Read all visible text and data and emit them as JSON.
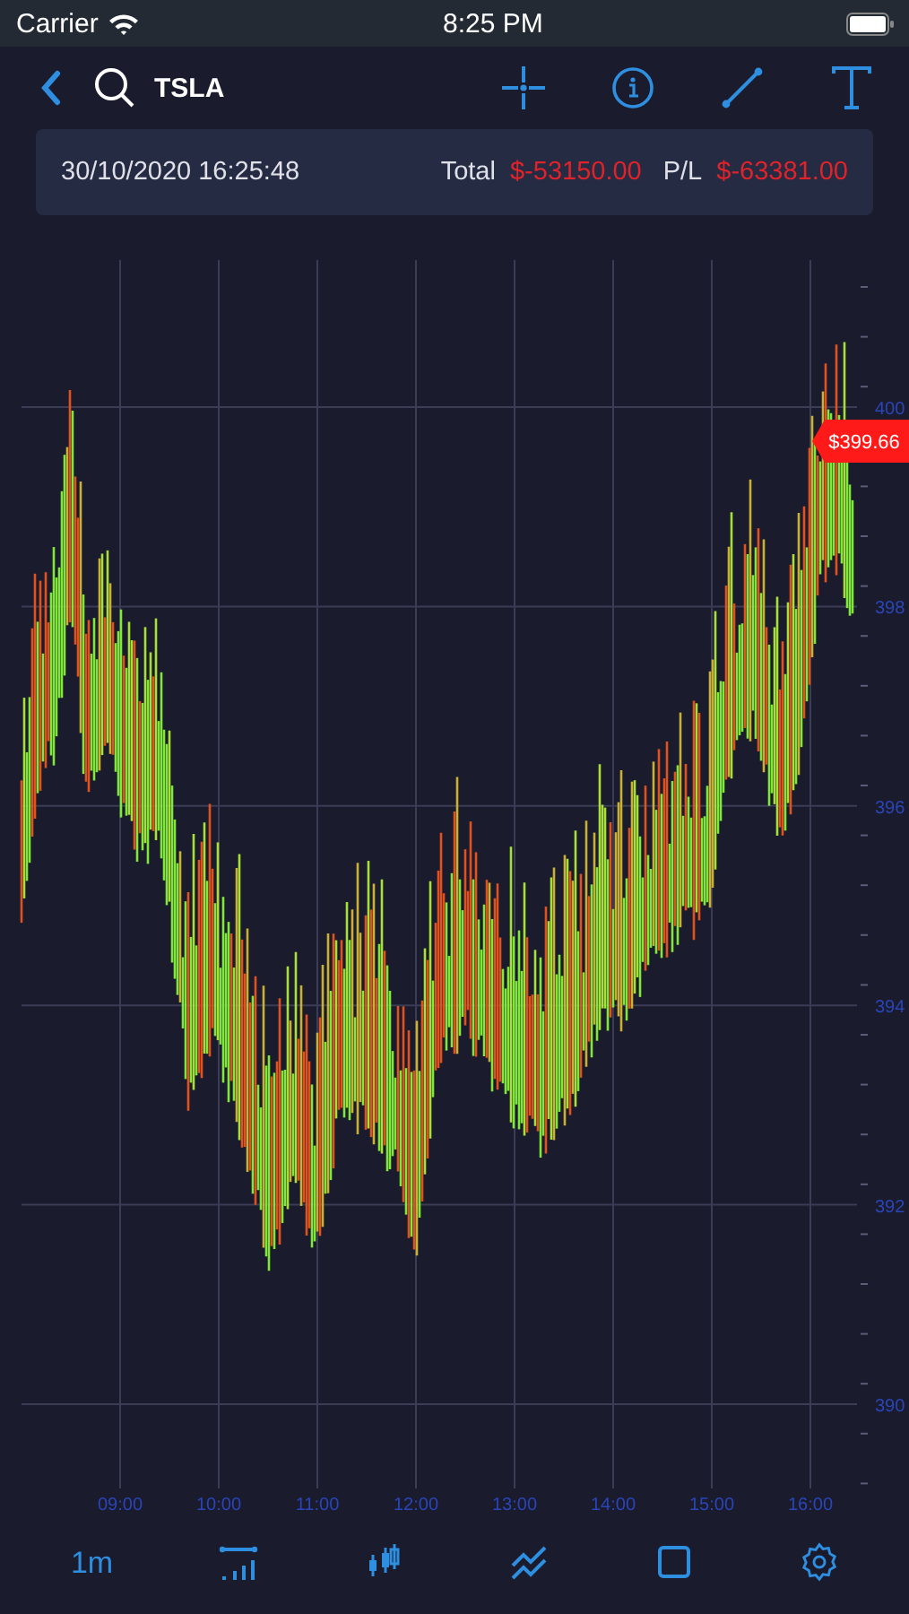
{
  "status_bar": {
    "carrier": "Carrier",
    "time": "8:25 PM"
  },
  "nav": {
    "symbol": "TSLA"
  },
  "info": {
    "datetime": "30/10/2020  16:25:48",
    "total_label": "Total",
    "total_value": "$-53150.00",
    "pl_label": "P/L",
    "pl_value": "$-63381.00"
  },
  "chart": {
    "y_labels": [
      "400",
      "398",
      "396",
      "394",
      "392",
      "390"
    ],
    "x_labels": [
      "09:00",
      "10:00",
      "11:00",
      "12:00",
      "13:00",
      "14:00",
      "15:00",
      "16:00"
    ],
    "price_tag": "$399.66"
  },
  "toolbar": {
    "interval": "1m"
  }
}
